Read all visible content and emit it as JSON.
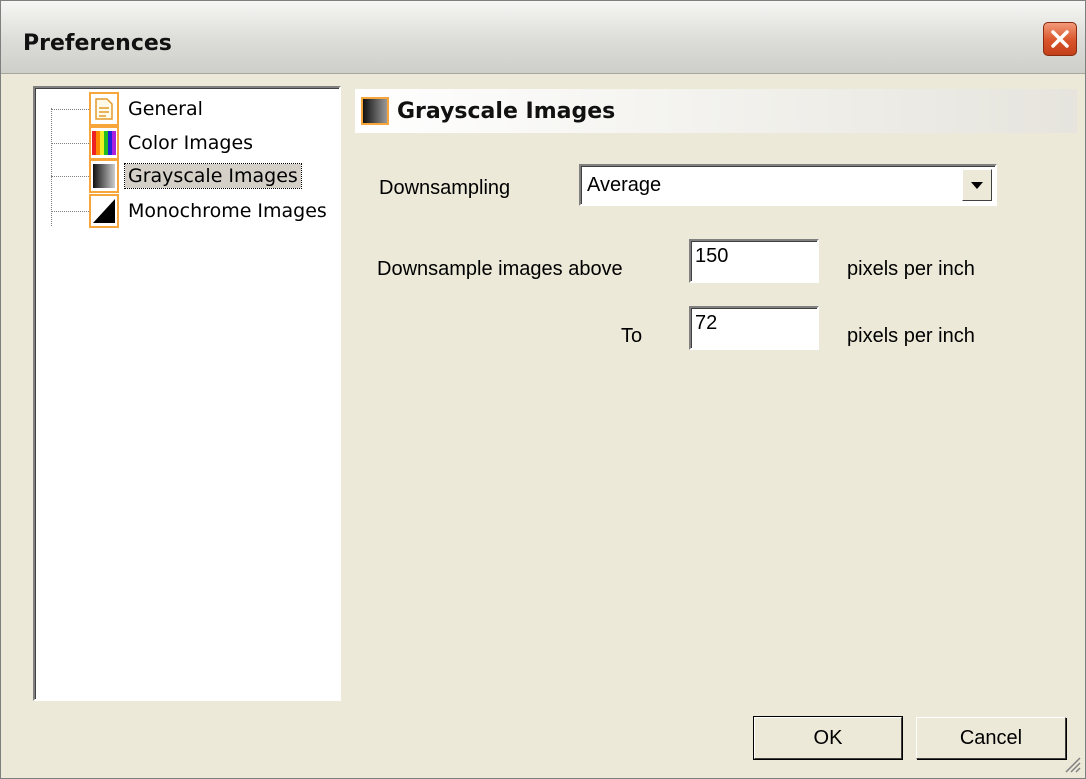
{
  "window": {
    "title": "Preferences"
  },
  "tree": {
    "items": [
      {
        "label": "General",
        "icon": "document-icon",
        "selected": false
      },
      {
        "label": "Color Images",
        "icon": "color-bars-icon",
        "selected": false
      },
      {
        "label": "Grayscale Images",
        "icon": "grayscale-gradient-icon",
        "selected": true
      },
      {
        "label": "Monochrome Images",
        "icon": "monochrome-icon",
        "selected": false
      }
    ]
  },
  "panel": {
    "title": "Grayscale Images",
    "downsampling": {
      "label": "Downsampling",
      "value": "Average"
    },
    "above": {
      "label": "Downsample images above",
      "value": "150",
      "unit": "pixels per inch"
    },
    "to": {
      "label": "To",
      "value": "72",
      "unit": "pixels per inch"
    }
  },
  "buttons": {
    "ok": "OK",
    "cancel": "Cancel"
  },
  "colors": {
    "accent": "#f7a63c",
    "close": "#d9542a",
    "background": "#ece9d8"
  }
}
